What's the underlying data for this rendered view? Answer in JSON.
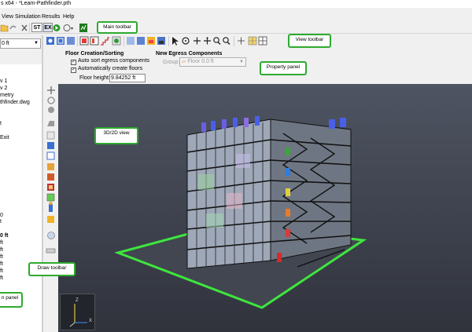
{
  "window": {
    "title": "s x64 - *Learn-Pathfinder.pth"
  },
  "menu": [
    "View",
    "Simulation",
    "Results",
    "Help"
  ],
  "main_toolbar": {
    "st_label": "ST",
    "ex_label": "EX"
  },
  "floor_combo": {
    "value": "0 ft"
  },
  "nav_panel": {
    "items": [
      "v 1",
      "v 2",
      "metry",
      "thfinder.dwg",
      "t",
      "Exit",
      "0",
      "t",
      "0 ft",
      "ft",
      "ft",
      "ft",
      "ft",
      "ft",
      "ft"
    ]
  },
  "property_panel": {
    "floor_section_title": "Floor Creation/Sorting",
    "auto_sort_label": "Auto sort egress components",
    "auto_create_label": "Automatically create floors",
    "auto_sort_checked": true,
    "auto_create_checked": true,
    "floor_height_label": "Floor height:",
    "floor_height_value": "9.84252 ft",
    "new_egress_title": "New Egress Components",
    "group_label": "Group:",
    "group_value": "Floor 0.0 ft"
  },
  "axes": {
    "z": "Z",
    "x": "X"
  },
  "callouts": {
    "main_toolbar": "Main toolbar",
    "view_toolbar": "View toolbar",
    "property_panel": "Property panel",
    "view_3d": "3D/2D view",
    "draw_toolbar": "Draw toolbar",
    "nav_panel": "n panel"
  },
  "colors": {
    "callout_border": "#2eaa2e",
    "view_background": "#474b58",
    "floor_outline": "#3ee63e"
  }
}
